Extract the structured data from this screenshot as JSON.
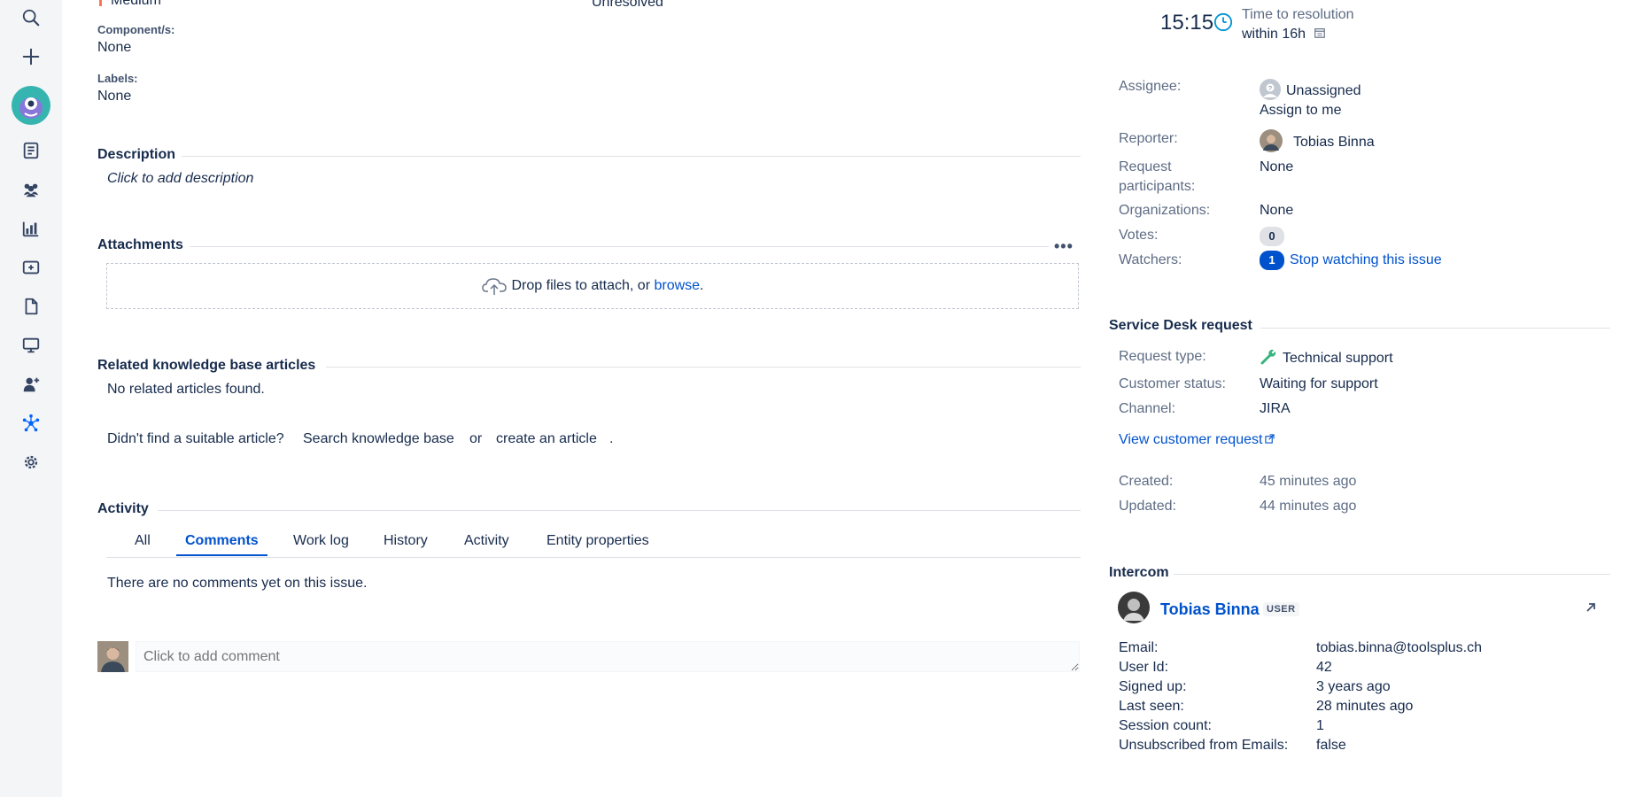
{
  "sidebar": {
    "items": [
      {
        "icon": "search-icon"
      },
      {
        "icon": "plus-icon"
      },
      {
        "icon": "project-avatar-icon"
      },
      {
        "icon": "queues-icon"
      },
      {
        "icon": "customers-icon"
      },
      {
        "icon": "reports-icon"
      },
      {
        "icon": "add-item-icon"
      },
      {
        "icon": "page-icon"
      },
      {
        "icon": "monitor-icon"
      },
      {
        "icon": "invite-user-icon"
      },
      {
        "icon": "network-icon"
      },
      {
        "icon": "settings-icon"
      }
    ]
  },
  "details": {
    "priority_value": "Medium",
    "resolution_value": "Unresolved",
    "components_label": "Component/s:",
    "components_value": "None",
    "labels_label": "Labels:",
    "labels_value": "None"
  },
  "description": {
    "title": "Description",
    "placeholder": "Click to add description"
  },
  "attachments": {
    "title": "Attachments",
    "drop_text": "Drop files to attach, or",
    "browse_link": "browse",
    "period": "."
  },
  "kb": {
    "title": "Related knowledge base articles",
    "none_text": "No related articles found.",
    "prompt": "Didn't find a suitable article?",
    "search_link": "Search knowledge base",
    "or_text": "or",
    "create_link": "create an article",
    "period": "."
  },
  "activity": {
    "title": "Activity",
    "tabs": [
      "All",
      "Comments",
      "Work log",
      "History",
      "Activity",
      "Entity properties"
    ],
    "active_tab": "Comments",
    "empty_text": "There are no comments yet on this issue.",
    "comment_placeholder": "Click to add comment"
  },
  "sla": {
    "time": "15:15",
    "name": "Time to resolution",
    "within": "within 16h"
  },
  "people": {
    "assignee_label": "Assignee:",
    "assignee_value": "Unassigned",
    "assign_to_me": "Assign to me",
    "reporter_label": "Reporter:",
    "reporter_value": "Tobias Binna",
    "participants_label_1": "Request",
    "participants_label_2": "participants:",
    "participants_value": "None",
    "organizations_label": "Organizations:",
    "organizations_value": "None",
    "votes_label": "Votes:",
    "votes_value": "0",
    "watchers_label": "Watchers:",
    "watchers_value": "1",
    "stop_watching": "Stop watching this issue"
  },
  "service_desk": {
    "title": "Service Desk request",
    "request_type_label": "Request type:",
    "request_type_value": "Technical support",
    "customer_status_label": "Customer status:",
    "customer_status_value": "Waiting for support",
    "channel_label": "Channel:",
    "channel_value": "JIRA",
    "view_request": "View customer request"
  },
  "dates": {
    "created_label": "Created:",
    "created_value": "45 minutes ago",
    "updated_label": "Updated:",
    "updated_value": "44 minutes ago"
  },
  "intercom": {
    "title": "Intercom",
    "user_name": "Tobias Binna",
    "user_badge": "USER",
    "rows": [
      {
        "label": "Email:",
        "value": "tobias.binna@toolsplus.ch"
      },
      {
        "label": "User Id:",
        "value": "42"
      },
      {
        "label": "Signed up:",
        "value": "3 years ago"
      },
      {
        "label": "Last seen:",
        "value": "28 minutes ago"
      },
      {
        "label": "Session count:",
        "value": "1"
      },
      {
        "label": "Unsubscribed from Emails:",
        "value": "false"
      }
    ]
  },
  "colors": {
    "link": "#0052cc",
    "sidebar_bg": "#f4f5f7",
    "avatar_teal": "#36b5b0",
    "sla_clock": "#0094d6"
  }
}
